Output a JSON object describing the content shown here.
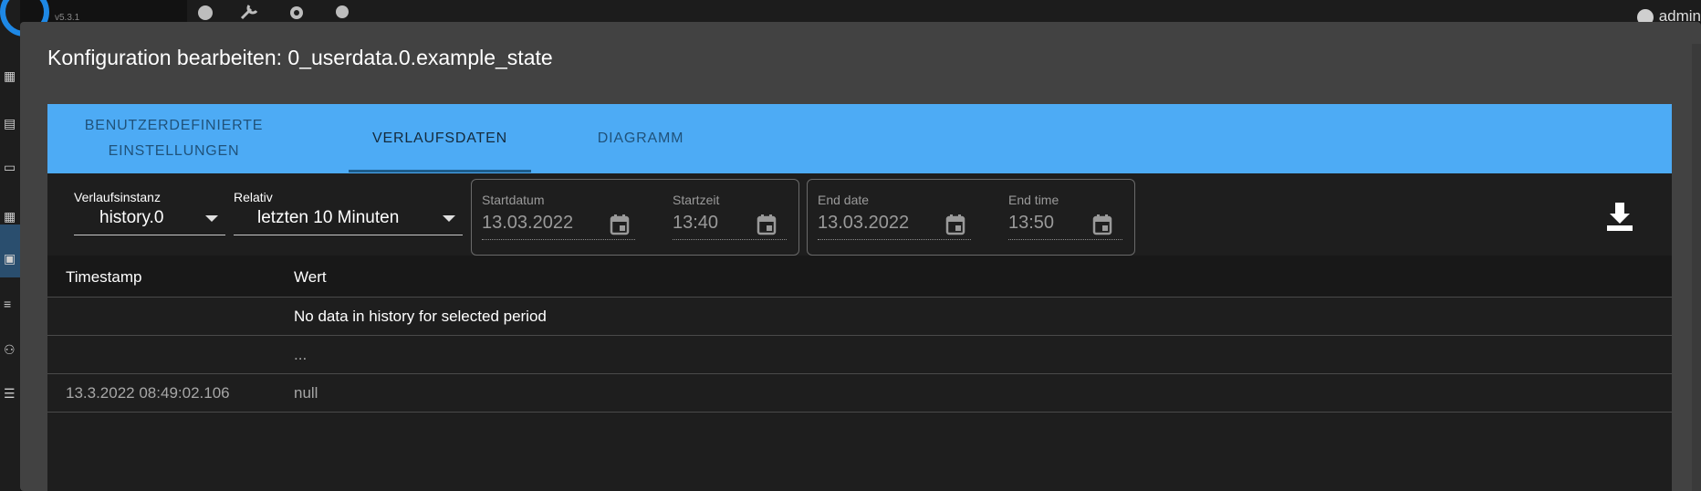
{
  "background": {
    "version": "v5.3.1",
    "user_label": "admin"
  },
  "dialog": {
    "title": "Konfiguration bearbeiten: 0_userdata.0.example_state",
    "tabs": [
      {
        "label_line1": "BENUTZERDEFINIERTE",
        "label_line2": "EINSTELLUNGEN",
        "active": false
      },
      {
        "label": "VERLAUFSDATEN",
        "active": true
      },
      {
        "label": "DIAGRAMM",
        "active": false
      }
    ],
    "toolbar": {
      "instance_label": "Verlaufsinstanz",
      "instance_value": "history.0",
      "relative_label": "Relativ",
      "relative_value": "letzten 10 Minuten",
      "start_date_label": "Startdatum",
      "start_date_value": "13.03.2022",
      "start_time_label": "Startzeit",
      "start_time_value": "13:40",
      "end_date_label": "End date",
      "end_date_value": "13.03.2022",
      "end_time_label": "End time",
      "end_time_value": "13:50",
      "download_icon": "download-icon"
    },
    "table": {
      "columns": [
        "Timestamp",
        "Wert"
      ],
      "rows": [
        {
          "timestamp": "",
          "value": "No data in history for selected period"
        },
        {
          "timestamp": "",
          "value": "..."
        },
        {
          "timestamp": "13.3.2022 08:49:02.106",
          "value": "null"
        }
      ]
    }
  },
  "colors": {
    "tab_bar": "#4dabf5",
    "dialog_bg": "#424242",
    "panel_bg": "#1e1e1e"
  }
}
